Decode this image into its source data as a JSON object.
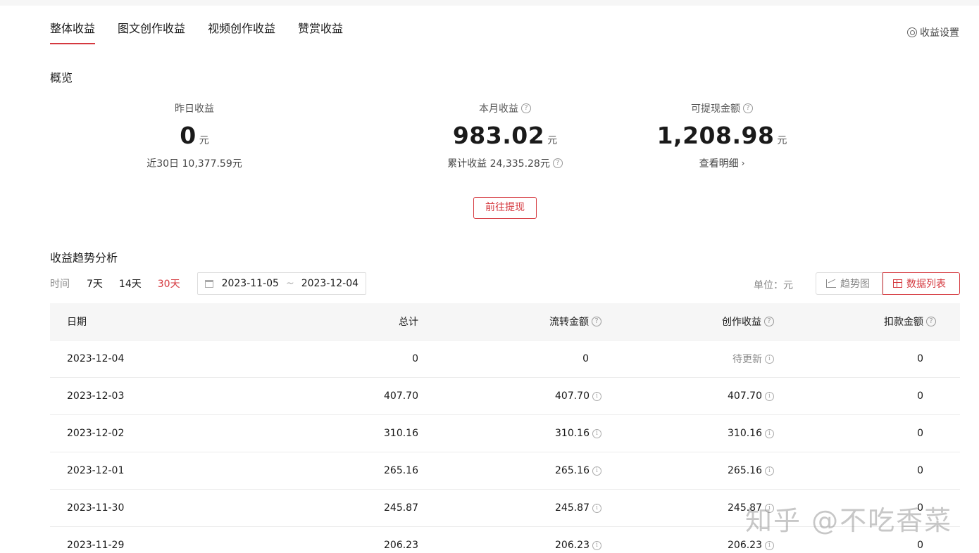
{
  "tabs": [
    {
      "label": "整体收益",
      "active": true
    },
    {
      "label": "图文创作收益",
      "active": false
    },
    {
      "label": "视频创作收益",
      "active": false
    },
    {
      "label": "赞赏收益",
      "active": false
    }
  ],
  "settings": {
    "label": "收益设置",
    "icon": "gear-icon"
  },
  "overview": {
    "title": "概览",
    "yesterday": {
      "label": "昨日收益",
      "value": "0",
      "unit": "元",
      "sub": "近30日 10,377.59元"
    },
    "month": {
      "label": "本月收益",
      "value": "983.02",
      "unit": "元",
      "sub": "累计收益 24,335.28元"
    },
    "withdrawable": {
      "label": "可提现金额",
      "value": "1,208.98",
      "unit": "元",
      "sub": "查看明细"
    },
    "withdraw_button": "前往提现"
  },
  "trend": {
    "title": "收益趋势分析",
    "time_label": "时间",
    "ranges": [
      "7天",
      "14天",
      "30天"
    ],
    "active_range": "30天",
    "date_start": "2023-11-05",
    "date_sep": "~",
    "date_end": "2023-12-04",
    "unit_label": "单位：元",
    "view_trend": "趋势图",
    "view_table": "数据列表"
  },
  "table": {
    "headers": [
      "日期",
      "总计",
      "流转金额",
      "创作收益",
      "扣款金额"
    ],
    "rows": [
      {
        "date": "2023-12-04",
        "total": "0",
        "flow": "0",
        "create": "待更新",
        "deduct": "0"
      },
      {
        "date": "2023-12-03",
        "total": "407.70",
        "flow": "407.70",
        "create": "407.70",
        "deduct": "0"
      },
      {
        "date": "2023-12-02",
        "total": "310.16",
        "flow": "310.16",
        "create": "310.16",
        "deduct": "0"
      },
      {
        "date": "2023-12-01",
        "total": "265.16",
        "flow": "265.16",
        "create": "265.16",
        "deduct": "0"
      },
      {
        "date": "2023-11-30",
        "total": "245.87",
        "flow": "245.87",
        "create": "245.87",
        "deduct": "0"
      },
      {
        "date": "2023-11-29",
        "total": "206.23",
        "flow": "206.23",
        "create": "206.23",
        "deduct": "0"
      }
    ]
  },
  "watermark": "知乎 @不吃香菜",
  "colors": {
    "accent": "#d5393f",
    "muted": "#888888",
    "header_bg": "#f6f6f6"
  }
}
